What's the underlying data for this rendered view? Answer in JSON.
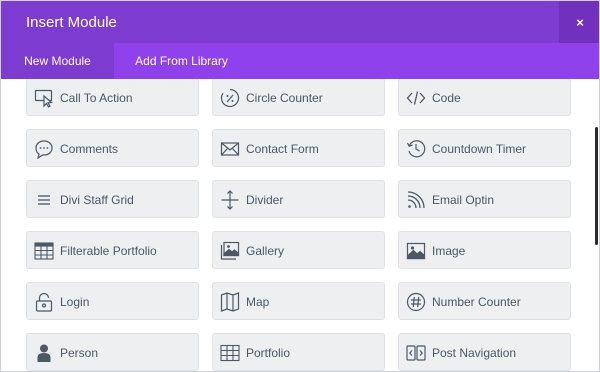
{
  "modal": {
    "title": "Insert Module",
    "close_label": "×"
  },
  "tabs": [
    {
      "label": "New Module",
      "active": true
    },
    {
      "label": "Add From Library",
      "active": false
    }
  ],
  "modules": [
    {
      "label": "Call To Action",
      "icon": "call-to-action-icon"
    },
    {
      "label": "Circle Counter",
      "icon": "circle-counter-icon"
    },
    {
      "label": "Code",
      "icon": "code-icon"
    },
    {
      "label": "Comments",
      "icon": "comments-icon"
    },
    {
      "label": "Contact Form",
      "icon": "envelope-icon"
    },
    {
      "label": "Countdown Timer",
      "icon": "countdown-timer-icon"
    },
    {
      "label": "Divi Staff Grid",
      "icon": "menu-lines-icon"
    },
    {
      "label": "Divider",
      "icon": "divider-icon"
    },
    {
      "label": "Email Optin",
      "icon": "rss-icon"
    },
    {
      "label": "Filterable Portfolio",
      "icon": "filterable-grid-icon"
    },
    {
      "label": "Gallery",
      "icon": "gallery-icon"
    },
    {
      "label": "Image",
      "icon": "image-icon"
    },
    {
      "label": "Login",
      "icon": "lock-icon"
    },
    {
      "label": "Map",
      "icon": "map-icon"
    },
    {
      "label": "Number Counter",
      "icon": "hash-icon"
    },
    {
      "label": "Person",
      "icon": "person-icon"
    },
    {
      "label": "Portfolio",
      "icon": "grid-icon"
    },
    {
      "label": "Post Navigation",
      "icon": "post-navigation-icon"
    }
  ],
  "colors": {
    "titlebar": "#7e3bd0",
    "tabs_bar": "#8f42ec",
    "module_bg": "#edeff1",
    "module_text": "#4c5866"
  }
}
